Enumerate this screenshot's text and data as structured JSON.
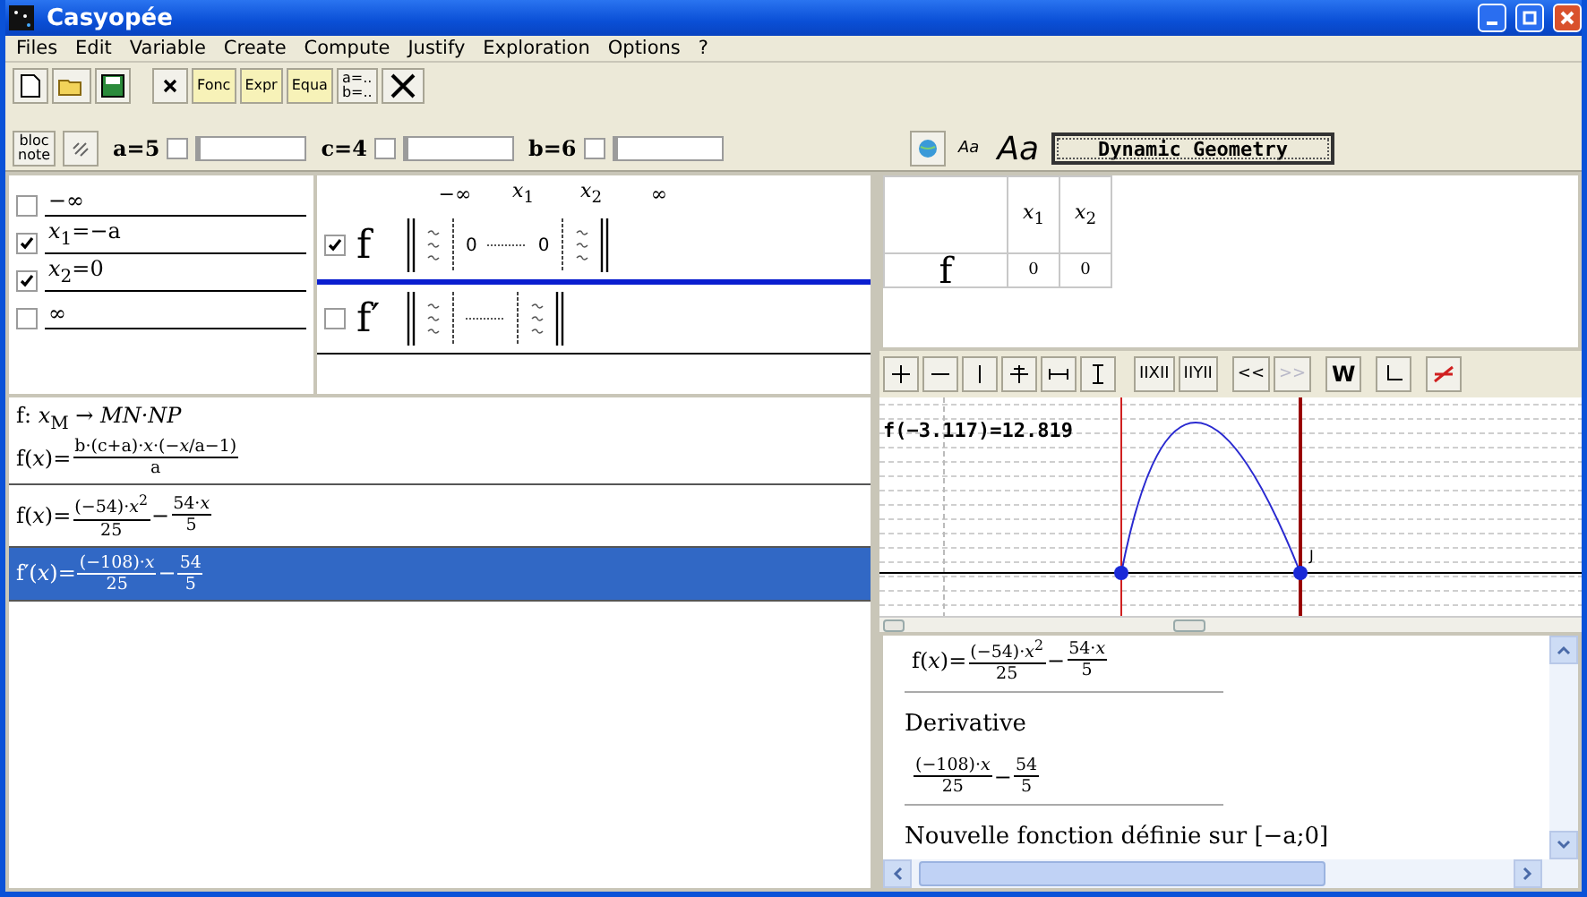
{
  "window": {
    "title": "Casyopée"
  },
  "menu": [
    "Files",
    "Edit",
    "Variable",
    "Create",
    "Compute",
    "Justify",
    "Exploration",
    "Options",
    "?"
  ],
  "toolbar": {
    "text_buttons": [
      "Fonc",
      "Expr",
      "Equa"
    ],
    "assign_button": [
      "a=..",
      "b=.."
    ]
  },
  "parameter_bar": {
    "note_button": [
      "bloc",
      "note"
    ],
    "parameters": [
      {
        "label": "a=5",
        "checked": false
      },
      {
        "label": "c=4",
        "checked": false
      },
      {
        "label": "b=6",
        "checked": false
      }
    ],
    "font_buttons": [
      "Aa",
      "Aa"
    ],
    "dynamic_geometry": "Dynamic Geometry"
  },
  "bounds": [
    {
      "label": "−∞",
      "checked": false
    },
    {
      "label": "*x*$_{1}$=−a",
      "checked": true
    },
    {
      "label": "*x*$_{2}$=0",
      "checked": true
    },
    {
      "label": "∞",
      "checked": false
    }
  ],
  "sign_table": {
    "header": [
      "−∞",
      "*x*$_{1}$",
      "*x*$_{2}$",
      "∞"
    ],
    "rows": [
      {
        "name": "f",
        "checked": true,
        "zeros": [
          "0",
          "0"
        ]
      },
      {
        "name": "f′",
        "checked": false,
        "zeros": []
      }
    ]
  },
  "expressions": [
    {
      "selected": false,
      "lines": [
        [
          {
            "kind": "text",
            "text": "f:  *x*$_{M}$ → *MN·NP*"
          }
        ],
        [
          {
            "kind": "text",
            "text": "f(*x*)="
          },
          {
            "kind": "frac",
            "num": "b·(c+a)·*x*·(−*x*/a−1)",
            "den": "a"
          }
        ]
      ]
    },
    {
      "selected": false,
      "lines": [
        [
          {
            "kind": "text",
            "text": "f(*x*)="
          },
          {
            "kind": "frac",
            "num": "(−54)·*x*$^{2}$",
            "den": "25"
          },
          {
            "kind": "text",
            "text": "−"
          },
          {
            "kind": "frac",
            "num": "54·*x*",
            "den": "5"
          }
        ]
      ]
    },
    {
      "selected": true,
      "lines": [
        [
          {
            "kind": "text",
            "text": "f′(*x*)="
          },
          {
            "kind": "frac",
            "num": "(−108)·*x*",
            "den": "25"
          },
          {
            "kind": "text",
            "text": "−"
          },
          {
            "kind": "frac",
            "num": "54",
            "den": "5"
          }
        ]
      ]
    }
  ],
  "values_table": {
    "columns": [
      "*x*$_{1}$",
      "*x*$_{2}$"
    ],
    "rows": [
      {
        "name": "f",
        "cells": [
          "0",
          "0"
        ]
      }
    ]
  },
  "graph_toolbar": [
    {
      "label": "IIXII",
      "disabled": false
    },
    {
      "label": "IIYII",
      "disabled": false
    },
    {
      "label": "<<",
      "disabled": false
    },
    {
      "label": ">>",
      "disabled": true
    },
    {
      "label": "W",
      "disabled": false
    }
  ],
  "graph": {
    "readout": "f(−3.117)=12.819",
    "point_label": "J"
  },
  "notebook": [
    {
      "kind": "formula",
      "parts": [
        {
          "kind": "text",
          "text": "f(*x*)="
        },
        {
          "kind": "frac",
          "num": "(−54)·*x*$^{2}$",
          "den": "25"
        },
        {
          "kind": "text",
          "text": "−"
        },
        {
          "kind": "frac",
          "num": "54·*x*",
          "den": "5"
        }
      ]
    },
    {
      "kind": "text",
      "text": "Derivative"
    },
    {
      "kind": "formula",
      "parts": [
        {
          "kind": "frac",
          "num": "(−108)·*x*",
          "den": "25"
        },
        {
          "kind": "text",
          "text": "−"
        },
        {
          "kind": "frac",
          "num": "54",
          "den": "5"
        }
      ]
    },
    {
      "kind": "text",
      "text": "Nouvelle fonction définie sur [−a;0]"
    }
  ]
}
